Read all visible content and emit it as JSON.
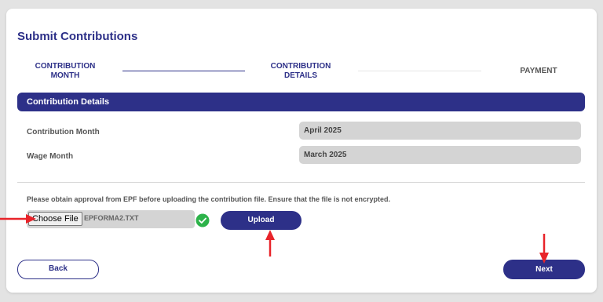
{
  "page": {
    "title": "Submit Contributions"
  },
  "stepper": {
    "steps": [
      {
        "label": "CONTRIBUTION\nMONTH",
        "state": "completed"
      },
      {
        "label": "CONTRIBUTION\nDETAILS",
        "state": "active"
      },
      {
        "label": "PAYMENT",
        "state": "pending"
      }
    ]
  },
  "section": {
    "title": "Contribution Details"
  },
  "fields": [
    {
      "label": "Contribution Month",
      "value": "April 2025"
    },
    {
      "label": "Wage Month",
      "value": "March 2025"
    }
  ],
  "upload": {
    "notice": "Please obtain approval from EPF before uploading the contribution file. Ensure that the file is not encrypted.",
    "choose_label": "Choose File",
    "file_name": "EPFORMA2.TXT",
    "upload_label": "Upload",
    "check_icon": "check-circle-icon"
  },
  "footer": {
    "back_label": "Back",
    "next_label": "Next"
  },
  "colors": {
    "primary": "#2d3088",
    "success": "#2db34a",
    "annotation": "#e8242a"
  }
}
